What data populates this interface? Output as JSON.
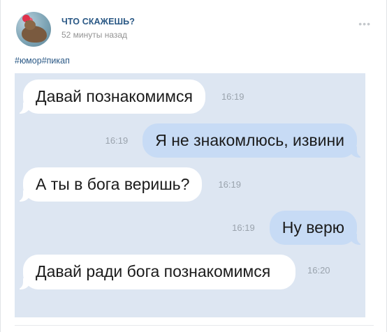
{
  "post": {
    "author": "ЧТО СКАЖЕШЬ?",
    "time_ago": "52 минуты назад",
    "more_icon": "ellipsis-icon",
    "hashtags": [
      "#юмор",
      "#пикап"
    ]
  },
  "chat": {
    "messages": [
      {
        "direction": "incoming",
        "text": "Давай познакомимся",
        "time": "16:19"
      },
      {
        "direction": "outgoing",
        "text": "Я не знакомлюсь, извини",
        "time": "16:19"
      },
      {
        "direction": "incoming",
        "text": "А ты в бога веришь?",
        "time": "16:19"
      },
      {
        "direction": "outgoing",
        "text": "Ну верю",
        "time": "16:19"
      },
      {
        "direction": "incoming",
        "text": "Давай ради бога познакомимся",
        "time": "16:20"
      }
    ]
  },
  "colors": {
    "link": "#2a5885",
    "chat_background": "#dde6f2",
    "incoming_bubble": "#ffffff",
    "outgoing_bubble": "#c7dbf5"
  }
}
